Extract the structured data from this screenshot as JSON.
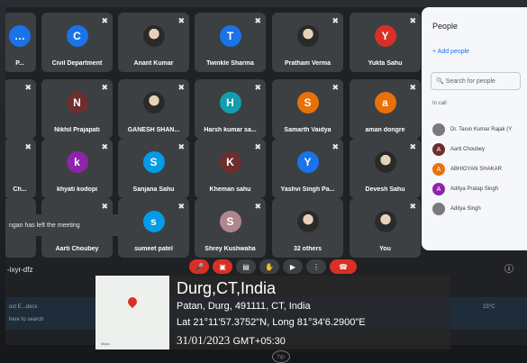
{
  "tiles": [
    {
      "name": "P...",
      "letter": "…",
      "color": "#1a73e8",
      "mic": false
    },
    {
      "name": "Civil Department",
      "letter": "C",
      "color": "#1a73e8",
      "mic": true
    },
    {
      "name": "Anant Kumar",
      "letter": "",
      "color": "photo",
      "mic": true
    },
    {
      "name": "Twinkle Sharma",
      "letter": "T",
      "color": "#1a73e8",
      "mic": true
    },
    {
      "name": "Pratham Verma",
      "letter": "",
      "color": "photo",
      "mic": true
    },
    {
      "name": "Yukta Sahu",
      "letter": "Y",
      "color": "#d93025",
      "mic": true
    },
    {
      "name": "",
      "letter": "",
      "color": "none",
      "mic": true
    },
    {
      "name": "Nikhil Prajapati",
      "letter": "N",
      "color": "#6d2e2e",
      "mic": true
    },
    {
      "name": "GANESH SHAN...",
      "letter": "",
      "color": "photo",
      "mic": true
    },
    {
      "name": "Harsh kumar sa...",
      "letter": "H",
      "color": "#129eaf",
      "mic": true
    },
    {
      "name": "Samarth Vaidya",
      "letter": "S",
      "color": "#e8710a",
      "mic": true
    },
    {
      "name": "aman dongre",
      "letter": "a",
      "color": "#e8710a",
      "mic": true
    },
    {
      "name": "Ch...",
      "letter": "",
      "color": "none",
      "mic": true
    },
    {
      "name": "khyati kodopi",
      "letter": "k",
      "color": "#8e24aa",
      "mic": true
    },
    {
      "name": "Sanjana Sahu",
      "letter": "S",
      "color": "#039be5",
      "mic": true
    },
    {
      "name": "Kheman sahu",
      "letter": "K",
      "color": "#6d2e2e",
      "mic": true
    },
    {
      "name": "Yashvi Singh Pa...",
      "letter": "Y",
      "color": "#1a73e8",
      "mic": true
    },
    {
      "name": "Devesh Sahu",
      "letter": "",
      "color": "photo",
      "mic": true
    },
    {
      "name": "",
      "letter": "",
      "color": "none",
      "mic": false
    },
    {
      "name": "Aarti Choubey",
      "letter": "",
      "color": "none",
      "mic": true
    },
    {
      "name": "sumeet patel",
      "letter": "s",
      "color": "#039be5",
      "mic": true
    },
    {
      "name": "Shrey Kushwaha",
      "letter": "S",
      "color": "#b0868c",
      "mic": true
    },
    {
      "name": "32 others",
      "letter": "",
      "color": "photo",
      "mic": false
    },
    {
      "name": "You",
      "letter": "",
      "color": "photo",
      "mic": true
    }
  ],
  "toast": "ngan has left the meeting",
  "meeting_code": "-ixyr-dfz",
  "people": {
    "title": "People",
    "add": "Add people",
    "search_placeholder": "Search for people",
    "in_call": "In call",
    "list": [
      {
        "name": "Dr. Tarun Kumar Rajak (Y",
        "letter": "",
        "color": "#7a7a7a"
      },
      {
        "name": "Aarti Choubey",
        "letter": "A",
        "color": "#6d2e2e"
      },
      {
        "name": "ABHIGYAN SHAKAR",
        "letter": "A",
        "color": "#e8710a"
      },
      {
        "name": "Aditya Pratap Singh",
        "letter": "A",
        "color": "#8e24aa"
      },
      {
        "name": "Aditya Singh",
        "letter": "",
        "color": "#7a7a7a"
      }
    ]
  },
  "taskbar": {
    "file1": "ost E...docx",
    "search": "here to search",
    "weather": "23°C"
  },
  "geo": {
    "city": "Durg,CT,India",
    "address": "Patan, Durg, 491111, CT, India",
    "coords": "Lat 21°11'57.3752\"N, Long 81°34'6.2900\"E",
    "date": "31/01/2023",
    "tz": "GMT+05:30",
    "map_label": "Maps"
  },
  "brand": "hp"
}
